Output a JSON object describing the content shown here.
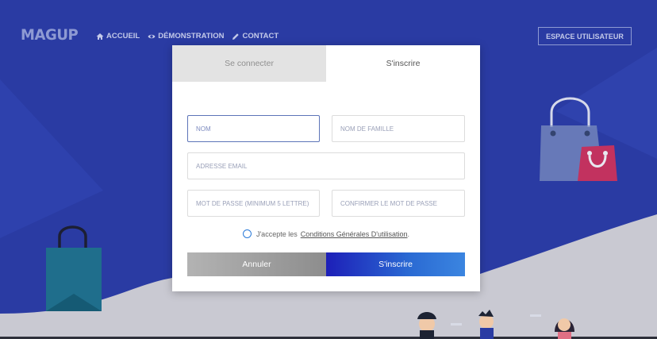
{
  "header": {
    "logo": "MAGUP",
    "nav": [
      {
        "icon": "home-icon",
        "label": "ACCUEIL"
      },
      {
        "icon": "eye-icon",
        "label": "DÉMONSTRATION"
      },
      {
        "icon": "pencil-icon",
        "label": "CONTACT"
      }
    ],
    "user_space_label": "ESPACE UTILISATEUR"
  },
  "modal": {
    "tabs": {
      "login": "Se connecter",
      "register": "S'inscrire",
      "active": "register"
    },
    "fields": {
      "first_name": {
        "placeholder": "NOM",
        "value": ""
      },
      "last_name": {
        "placeholder": "NOM DE FAMILLE",
        "value": ""
      },
      "email": {
        "placeholder": "ADRESSE EMAIL",
        "value": ""
      },
      "password": {
        "placeholder": "MOT DE PASSE (MINIMUM 5 LETTRE)",
        "value": ""
      },
      "confirm_password": {
        "placeholder": "CONFIRMER LE MOT DE PASSE",
        "value": ""
      }
    },
    "terms": {
      "prefix": "J'accepte les",
      "link": "Conditions Générales D'utilisation",
      "suffix": "."
    },
    "cancel_label": "Annuler",
    "submit_label": "S'inscrire"
  },
  "colors": {
    "background": "#2a3ba3",
    "wave": "#c9c9d2",
    "accent": "#1d1fb8",
    "bag_left": "#1f6e8c",
    "bag_right_front": "#c2325f"
  }
}
